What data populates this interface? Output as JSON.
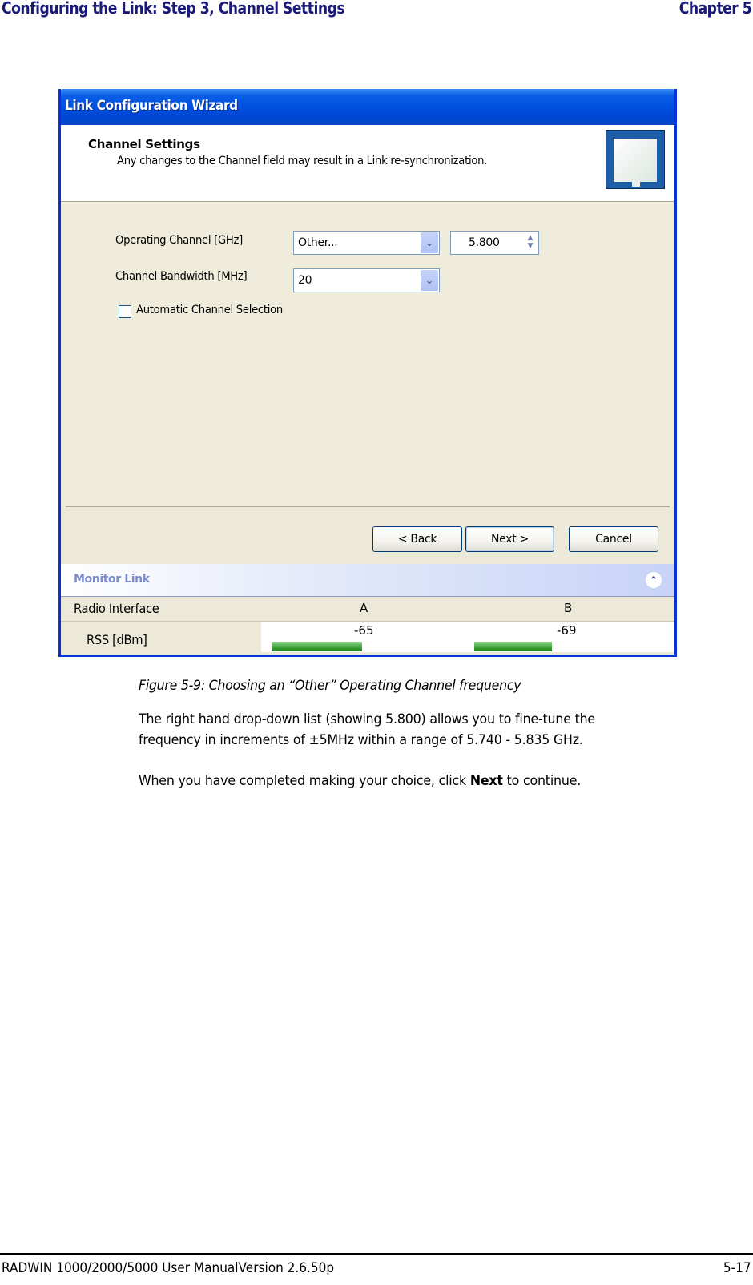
{
  "page_header": {
    "title": "Configuring the Link: Step 3, Channel Settings",
    "chapter": "Chapter 5"
  },
  "window": {
    "title": "Link Configuration Wizard",
    "header": {
      "title": "Channel Settings",
      "subtitle": "Any changes to the Channel field may result in a Link re-synchronization.",
      "icon": "wizard-device-icon"
    },
    "fields": {
      "operating_channel_label": "Operating Channel [GHz]",
      "operating_channel_value": "Other...",
      "frequency_value": "5.800",
      "bandwidth_label": "Channel Bandwidth [MHz]",
      "bandwidth_value": "20",
      "auto_channel_label": "Automatic Channel Selection",
      "auto_channel_checked": false
    },
    "buttons": {
      "back": "< Back",
      "next": "Next >",
      "cancel": "Cancel"
    },
    "monitor": {
      "title": "Monitor Link",
      "collapse_icon": "double-chevron-up-icon",
      "radio_interface_label": "Radio Interface",
      "col_a": "A",
      "col_b": "B",
      "rss_label": "RSS [dBm]",
      "rss_a": "-65",
      "rss_b": "-69",
      "rss_a_level": 0.42,
      "rss_b_level": 0.36,
      "bar_color": "#3fa83a"
    }
  },
  "caption": "Figure 5-9: Choosing an “Other” Operating Channel frequency",
  "paragraphs": {
    "p1_line1": "The right hand drop-down list (showing 5.800) allows you to fine-tune the",
    "p1_line2": "frequency in increments of ±5MHz within a range of 5.740 - 5.835 GHz.",
    "p2_before": "When you have completed making your choice, click ",
    "p2_bold": "Next",
    "p2_after": " to continue."
  },
  "page_footer": {
    "left": "RADWIN 1000/2000/5000 User ManualVersion  2.6.50p",
    "right": "5-17"
  },
  "colors": {
    "header_text": "#1a1a7a",
    "titlebar": "#0050e0"
  }
}
